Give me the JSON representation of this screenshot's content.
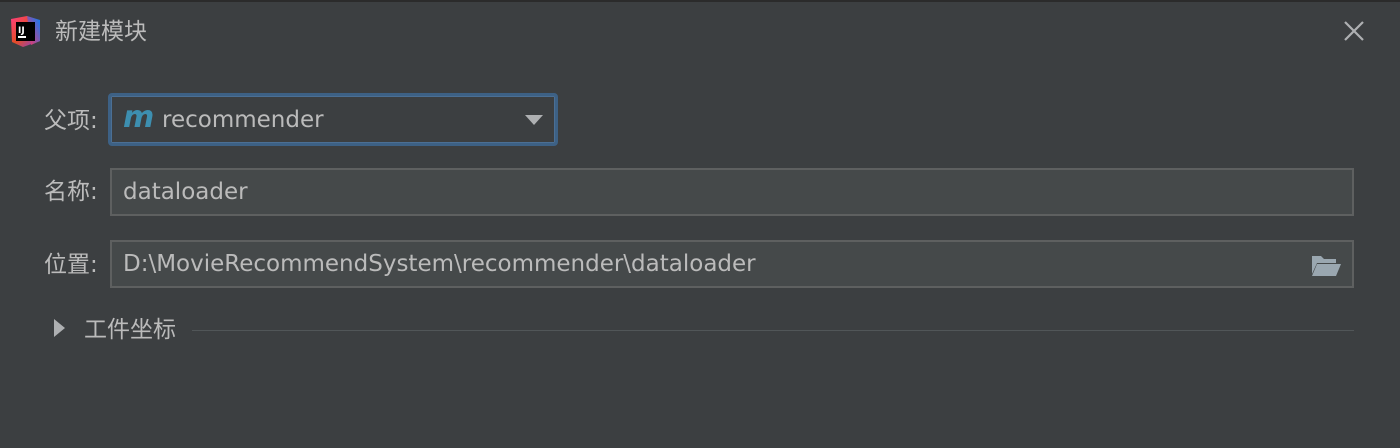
{
  "dialog": {
    "title": "新建模块",
    "app_icon": "intellij-idea-icon",
    "close_icon": "close-icon"
  },
  "form": {
    "parent": {
      "label": "父项:",
      "icon": "maven-module-icon",
      "icon_glyph": "m",
      "value": "recommender"
    },
    "name": {
      "label": "名称:",
      "value": "dataloader"
    },
    "location": {
      "label": "位置:",
      "value": "D:\\MovieRecommendSystem\\recommender\\dataloader",
      "browse_icon": "folder-open-icon"
    }
  },
  "artifact_section": {
    "label": "工件坐标",
    "expanded": false
  },
  "colors": {
    "background": "#3c3f41",
    "field_background": "#45494a",
    "focus_border": "#3d6185",
    "text": "#bbbbbb",
    "maven_icon": "#3d8fb0"
  }
}
